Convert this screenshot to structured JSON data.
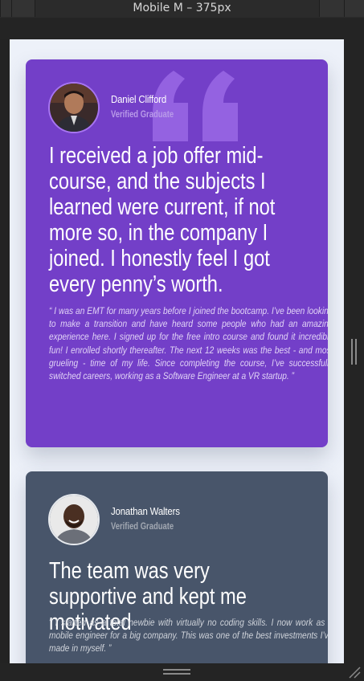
{
  "devtools": {
    "device_label": "Mobile M – 375px"
  },
  "colors": {
    "card_1_bg": "#733fc8",
    "card_2_bg": "#48556a",
    "page_bg": "#edf1f9"
  },
  "testimonials": [
    {
      "avatar_icon": "avatar-photo-man-suit",
      "name": "Daniel Clifford",
      "role": "Verified Graduate",
      "headline": "I received a job offer mid-course, and the subjects I learned were current, if not more so, in the company I joined. I honestly feel I got every penny’s worth.",
      "body": "“ I was an EMT for many years before I joined the bootcamp. I’ve been looking to make a transition and have heard some people who had an amazing experience here. I signed up for the free intro course and found it incredibly fun! I enrolled shortly thereafter. The next 12 weeks was the best - and most grueling - time of my life. Since completing the course, I’ve successfully switched careers, working as a Software Engineer at a VR startup. ”"
    },
    {
      "avatar_icon": "avatar-photo-smiling-man",
      "name": "Jonathan Walters",
      "role": "Verified Graduate",
      "headline": "The team was very supportive and kept me motivated",
      "body": "“ I started as a total newbie with virtually no coding skills. I now work as a mobile engineer for a big company. This was one of the best investments I’ve made in myself. ”"
    }
  ]
}
